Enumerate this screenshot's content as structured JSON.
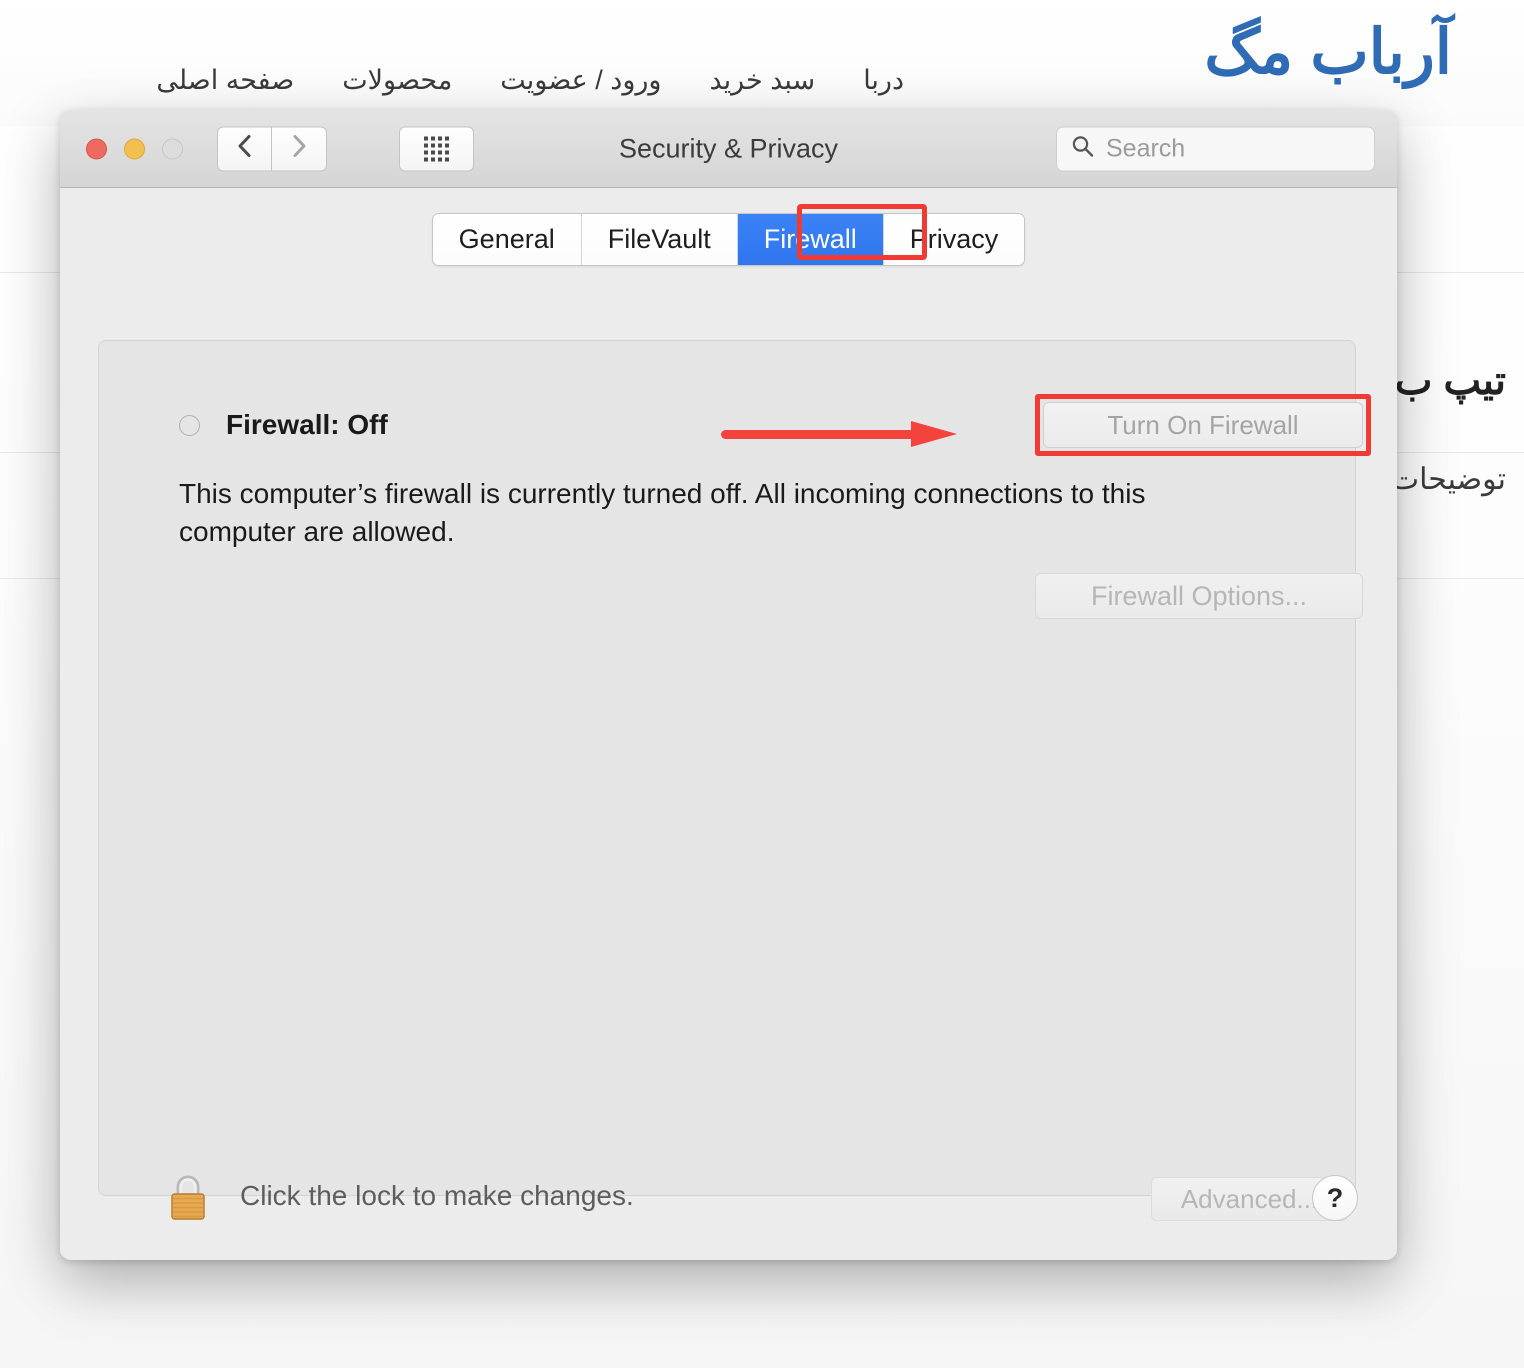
{
  "site": {
    "logo": "آرباب مگ",
    "nav": [
      {
        "label": "دربا"
      },
      {
        "label": "سبد خرید"
      },
      {
        "label": "ورود / عضویت"
      },
      {
        "label": "محصولات"
      },
      {
        "label": "صفحه اصلی"
      }
    ],
    "background_heading": "تیپ ب",
    "background_subtext": "توضیحات"
  },
  "window": {
    "title": "Security & Privacy",
    "traffic_lights": {
      "close": "close-button",
      "minimize": "minimize-button",
      "zoom": "zoom-button"
    },
    "toolbar": {
      "back_icon": "chevron-left-icon",
      "forward_icon": "chevron-right-icon",
      "grid_icon": "show-all-grid-icon"
    },
    "search": {
      "icon": "search-icon",
      "placeholder": "Search",
      "value": ""
    }
  },
  "tabs": [
    {
      "label": "General",
      "active": false
    },
    {
      "label": "FileVault",
      "active": false
    },
    {
      "label": "Firewall",
      "active": true
    },
    {
      "label": "Privacy",
      "active": false
    }
  ],
  "firewall": {
    "status_label": "Firewall: Off",
    "status_indicator": "status-off-circle",
    "turn_on_button": "Turn On Firewall",
    "turn_on_enabled": false,
    "description": "This computer’s firewall is currently turned off. All incoming connections to this computer are allowed.",
    "options_button": "Firewall Options...",
    "options_enabled": false
  },
  "bottom_bar": {
    "lock_icon": "closed-padlock-icon",
    "lock_caption": "Click the lock to make changes.",
    "advanced_button": "Advanced...",
    "advanced_enabled": false,
    "help_button": "?"
  },
  "annotations": {
    "highlight_color": "#ef3b33",
    "arrow_color": "#f4433c",
    "tab_highlight_target": "Firewall",
    "button_highlight_target": "Turn On Firewall",
    "arrow_points_to": "Turn On Firewall"
  },
  "colors": {
    "accent_blue": "#3b82f6",
    "logo_blue": "#2f6cb5",
    "window_bg": "#ececec",
    "panel_bg": "#e5e5e5"
  }
}
